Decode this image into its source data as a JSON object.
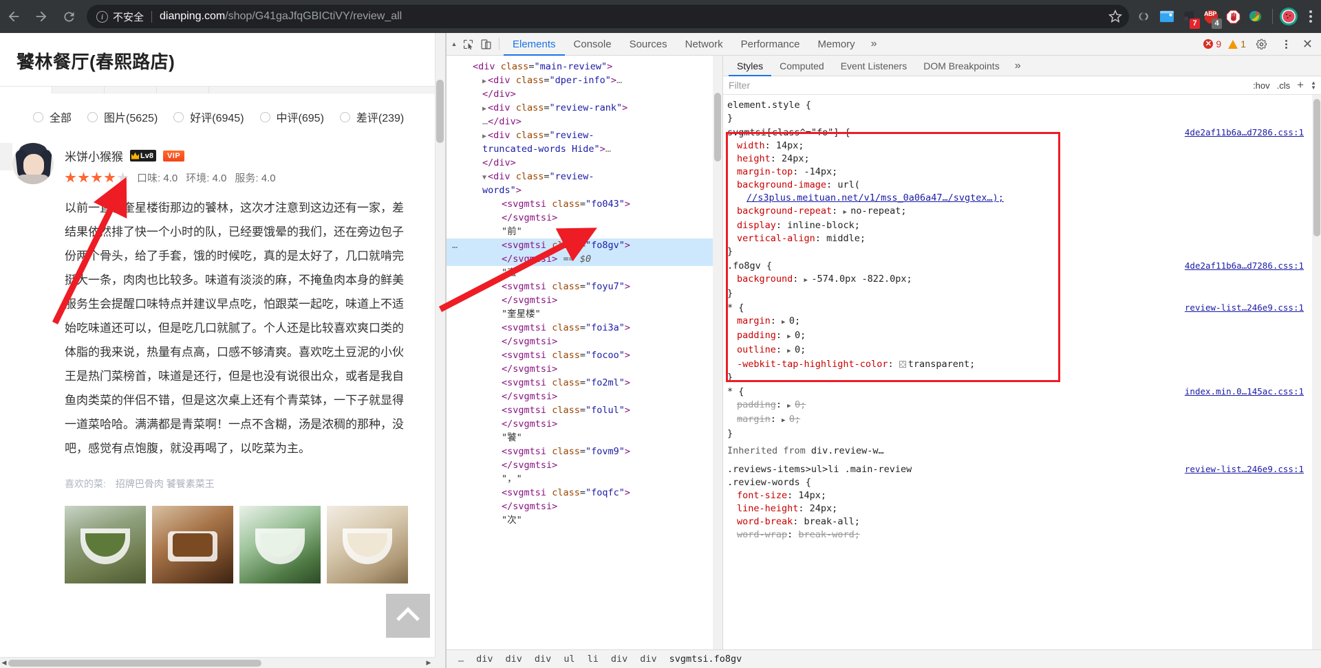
{
  "browser": {
    "back_icon": "back-arrow-icon",
    "forward_icon": "forward-arrow-icon",
    "reload_icon": "reload-icon",
    "security_label": "不安全",
    "url_host": "dianping.com",
    "url_path": "/shop/G41gaJfqGBICtiVY/review_all",
    "star_icon": "bookmark-star-icon",
    "extensions": [
      {
        "name": "link-extension-icon",
        "badge": ""
      },
      {
        "name": "window-extension-icon",
        "badge": ""
      },
      {
        "name": "dark-square-extension-icon",
        "badge": "7"
      },
      {
        "name": "adblock-plus-icon",
        "label": "ABP",
        "badge": "4"
      },
      {
        "name": "adblock-stop-hand-icon",
        "badge": ""
      },
      {
        "name": "colorful-globe-extension-icon",
        "badge": ""
      }
    ],
    "profile_icon": "watermelon-avatar-icon",
    "menu_icon": "three-dot-menu-icon"
  },
  "page": {
    "title": "饕林餐厅(春熙路店)",
    "filters": [
      {
        "label": "全部"
      },
      {
        "label": "图片(5625)"
      },
      {
        "label": "好评(6945)"
      },
      {
        "label": "中评(695)"
      },
      {
        "label": "差评(239)"
      }
    ],
    "review": {
      "user_name": "米饼小猴猴",
      "level_badge": "Lv8",
      "vip_badge": "VIP",
      "stars_filled": 4,
      "stars_total": 5,
      "scores": [
        {
          "label": "口味:",
          "value": "4.0"
        },
        {
          "label": "环境:",
          "value": "4.0"
        },
        {
          "label": "服务:",
          "value": "4.0"
        }
      ],
      "text_lines": [
        "以前一直在奎星楼街那边的饕林，这次才注意到这边还有一家，差",
        "结果依然排了快一个小时的队，已经要饿晕的我们，还在旁边包子",
        "份两个骨头，给了手套，饿的时候吃，真的是太好了，几口就啃完",
        "挺大一条，肉肉也比较多。味道有淡淡的麻，不掩鱼肉本身的鲜美",
        "服务生会提醒口味特点并建议早点吃，怕跟菜一起吃，味道上不适",
        "始吃味道还可以，但是吃几口就腻了。个人还是比较喜欢爽口类的",
        "体脂的我来说，热量有点高，口感不够清爽。喜欢吃土豆泥的小伙",
        "王是热门菜榜首，味道是还行，但是也没有说很出众，或者是我自",
        "鱼肉类菜的伴侣不错，但是这次桌上还有个青菜钵，一下子就显得",
        "一道菜哈哈。满满都是青菜啊！一点不含糊，汤是浓稠的那种，没",
        "吧，感觉有点饱腹，就没再喝了，以吃菜为主。"
      ],
      "liked_label": "喜欢的菜:",
      "liked_dishes": "招牌巴骨肉  饕餮素菜王",
      "photo_count": 4
    },
    "back_to_top_icon": "back-to-top-chevron-icon"
  },
  "devtools": {
    "inspect_icon": "inspect-element-icon",
    "device_icon": "device-toolbar-icon",
    "tabs": [
      {
        "label": "Elements",
        "active": true
      },
      {
        "label": "Console",
        "active": false
      },
      {
        "label": "Sources",
        "active": false
      },
      {
        "label": "Network",
        "active": false
      },
      {
        "label": "Performance",
        "active": false
      },
      {
        "label": "Memory",
        "active": false
      }
    ],
    "more_tabs_icon": "chevron-double-right-icon",
    "error_count": "9",
    "warning_count": "1",
    "settings_icon": "gear-icon",
    "kebab_icon": "three-dot-menu-icon",
    "close_icon": "close-icon",
    "dom_lines": [
      {
        "indent": 2,
        "tri": "",
        "html": "<span class=\"punct\">&lt;</span><span class=\"tag\">div</span> <span class=\"attr\">class</span>=<span class=\"val\">\"main-review\"</span><span class=\"punct\">&gt;</span>",
        "sel": false
      },
      {
        "indent": 3,
        "tri": "right",
        "html": "<span class=\"punct\">&lt;</span><span class=\"tag\">div</span> <span class=\"attr\">class</span>=<span class=\"val\">\"dper-info\"</span><span class=\"punct\">&gt;</span><span class=\"ellip\">…</span>",
        "sel": false
      },
      {
        "indent": 3,
        "tri": "",
        "html": "<span class=\"punct\">&lt;/</span><span class=\"tag\">div</span><span class=\"punct\">&gt;</span>",
        "sel": false
      },
      {
        "indent": 3,
        "tri": "right",
        "html": "<span class=\"punct\">&lt;</span><span class=\"tag\">div</span> <span class=\"attr\">class</span>=<span class=\"val\">\"review-rank\"</span><span class=\"punct\">&gt;</span>",
        "sel": false
      },
      {
        "indent": 3,
        "tri": "",
        "html": "<span class=\"ellip\">…</span><span class=\"punct\">&lt;/</span><span class=\"tag\">div</span><span class=\"punct\">&gt;</span>",
        "sel": false
      },
      {
        "indent": 3,
        "tri": "right",
        "html": "<span class=\"punct\">&lt;</span><span class=\"tag\">div</span> <span class=\"attr\">class</span>=<span class=\"val\">\"review-</span>",
        "sel": false
      },
      {
        "indent": 3,
        "tri": "",
        "html": "<span class=\"val\">truncated-words Hide\"</span><span class=\"punct\">&gt;</span><span class=\"ellip\">…</span>",
        "sel": false
      },
      {
        "indent": 3,
        "tri": "",
        "html": "<span class=\"punct\">&lt;/</span><span class=\"tag\">div</span><span class=\"punct\">&gt;</span>",
        "sel": false
      },
      {
        "indent": 3,
        "tri": "down",
        "html": "<span class=\"punct\">&lt;</span><span class=\"tag\">div</span> <span class=\"attr\">class</span>=<span class=\"val\">\"review-</span>",
        "sel": false
      },
      {
        "indent": 3,
        "tri": "",
        "html": "<span class=\"val\">words\"</span><span class=\"punct\">&gt;</span>",
        "sel": false
      },
      {
        "indent": 5,
        "tri": "",
        "html": "<span class=\"punct\">&lt;</span><span class=\"tag\">svgmtsi</span> <span class=\"attr\">class</span>=<span class=\"val\">\"fo043\"</span><span class=\"punct\">&gt;</span>",
        "sel": false
      },
      {
        "indent": 5,
        "tri": "",
        "html": "<span class=\"punct\">&lt;/</span><span class=\"tag\">svgmtsi</span><span class=\"punct\">&gt;</span>",
        "sel": false
      },
      {
        "indent": 5,
        "tri": "",
        "html": "<span class=\"txt\">\"前\"</span>",
        "sel": false
      },
      {
        "indent": 5,
        "tri": "",
        "html": "<span class=\"punct\">&lt;</span><span class=\"tag\">svgmtsi</span> <span class=\"attr\">class</span>=<span class=\"val\">\"fo8gv\"</span><span class=\"punct\">&gt;</span>",
        "sel": true
      },
      {
        "indent": 5,
        "tri": "",
        "html": "<span class=\"punct\">&lt;/</span><span class=\"tag\">svgmtsi</span><span class=\"punct\">&gt;</span> <span class=\"dollar\">== $0</span>",
        "sel": true
      },
      {
        "indent": 5,
        "tri": "",
        "html": "<span class=\"txt\">\"直\"</span>",
        "sel": false
      },
      {
        "indent": 5,
        "tri": "",
        "html": "<span class=\"punct\">&lt;</span><span class=\"tag\">svgmtsi</span> <span class=\"attr\">class</span>=<span class=\"val\">\"foyu7\"</span><span class=\"punct\">&gt;</span>",
        "sel": false
      },
      {
        "indent": 5,
        "tri": "",
        "html": "<span class=\"punct\">&lt;/</span><span class=\"tag\">svgmtsi</span><span class=\"punct\">&gt;</span>",
        "sel": false
      },
      {
        "indent": 5,
        "tri": "",
        "html": "<span class=\"txt\">\"奎星楼\"</span>",
        "sel": false
      },
      {
        "indent": 5,
        "tri": "",
        "html": "<span class=\"punct\">&lt;</span><span class=\"tag\">svgmtsi</span> <span class=\"attr\">class</span>=<span class=\"val\">\"foi3a\"</span><span class=\"punct\">&gt;</span>",
        "sel": false
      },
      {
        "indent": 5,
        "tri": "",
        "html": "<span class=\"punct\">&lt;/</span><span class=\"tag\">svgmtsi</span><span class=\"punct\">&gt;</span>",
        "sel": false
      },
      {
        "indent": 5,
        "tri": "",
        "html": "<span class=\"punct\">&lt;</span><span class=\"tag\">svgmtsi</span> <span class=\"attr\">class</span>=<span class=\"val\">\"focoo\"</span><span class=\"punct\">&gt;</span>",
        "sel": false
      },
      {
        "indent": 5,
        "tri": "",
        "html": "<span class=\"punct\">&lt;/</span><span class=\"tag\">svgmtsi</span><span class=\"punct\">&gt;</span>",
        "sel": false
      },
      {
        "indent": 5,
        "tri": "",
        "html": "<span class=\"punct\">&lt;</span><span class=\"tag\">svgmtsi</span> <span class=\"attr\">class</span>=<span class=\"val\">\"fo2ml\"</span><span class=\"punct\">&gt;</span>",
        "sel": false
      },
      {
        "indent": 5,
        "tri": "",
        "html": "<span class=\"punct\">&lt;/</span><span class=\"tag\">svgmtsi</span><span class=\"punct\">&gt;</span>",
        "sel": false
      },
      {
        "indent": 5,
        "tri": "",
        "html": "<span class=\"punct\">&lt;</span><span class=\"tag\">svgmtsi</span> <span class=\"attr\">class</span>=<span class=\"val\">\"folul\"</span><span class=\"punct\">&gt;</span>",
        "sel": false
      },
      {
        "indent": 5,
        "tri": "",
        "html": "<span class=\"punct\">&lt;/</span><span class=\"tag\">svgmtsi</span><span class=\"punct\">&gt;</span>",
        "sel": false
      },
      {
        "indent": 5,
        "tri": "",
        "html": "<span class=\"txt\">\"饕\"</span>",
        "sel": false
      },
      {
        "indent": 5,
        "tri": "",
        "html": "<span class=\"punct\">&lt;</span><span class=\"tag\">svgmtsi</span> <span class=\"attr\">class</span>=<span class=\"val\">\"fovm9\"</span><span class=\"punct\">&gt;</span>",
        "sel": false
      },
      {
        "indent": 5,
        "tri": "",
        "html": "<span class=\"punct\">&lt;/</span><span class=\"tag\">svgmtsi</span><span class=\"punct\">&gt;</span>",
        "sel": false
      },
      {
        "indent": 5,
        "tri": "",
        "html": "<span class=\"txt\">\"，\"</span>",
        "sel": false
      },
      {
        "indent": 5,
        "tri": "",
        "html": "<span class=\"punct\">&lt;</span><span class=\"tag\">svgmtsi</span> <span class=\"attr\">class</span>=<span class=\"val\">\"foqfc\"</span><span class=\"punct\">&gt;</span>",
        "sel": false
      },
      {
        "indent": 5,
        "tri": "",
        "html": "<span class=\"punct\">&lt;/</span><span class=\"tag\">svgmtsi</span><span class=\"punct\">&gt;</span>",
        "sel": false
      },
      {
        "indent": 5,
        "tri": "",
        "html": "<span class=\"txt\">\"次\"</span>",
        "sel": false
      }
    ],
    "styles_tabs": [
      {
        "label": "Styles",
        "active": true
      },
      {
        "label": "Computed",
        "active": false
      },
      {
        "label": "Event Listeners",
        "active": false
      },
      {
        "label": "DOM Breakpoints",
        "active": false
      }
    ],
    "styles_more_icon": "chevron-double-right-icon",
    "filter_placeholder": "Filter",
    "hov_label": ":hov",
    "cls_label": ".cls",
    "plus_label": "+",
    "element_style": "element.style {",
    "element_style_close": "}",
    "rules": [
      {
        "selector": "svgmtsi[class^=\"fo\"] {",
        "source": "4de2af11b6a…d7286.css:1",
        "close": "}",
        "declarations": [
          {
            "prop": "width",
            "value": "14px;"
          },
          {
            "prop": "height",
            "value": "24px;"
          },
          {
            "prop": "margin-top",
            "value": "-14px;"
          },
          {
            "prop": "background-image",
            "value": "url("
          },
          {
            "prop": "",
            "value": "//s3plus.meituan.net/v1/mss_0a06a47…/svgtex…);",
            "link": true,
            "indent": true
          },
          {
            "prop": "background-repeat",
            "value": "no-repeat;",
            "arrow": true
          },
          {
            "prop": "display",
            "value": "inline-block;"
          },
          {
            "prop": "vertical-align",
            "value": "middle;"
          }
        ]
      },
      {
        "selector": ".fo8gv {",
        "source": "4de2af11b6a…d7286.css:1",
        "close": "}",
        "declarations": [
          {
            "prop": "background",
            "value": "-574.0px -822.0px;",
            "arrow": true
          }
        ]
      },
      {
        "selector": "* {",
        "source": "review-list…246e9.css:1",
        "close": "}",
        "declarations": [
          {
            "prop": "margin",
            "value": "0;",
            "arrow": true
          },
          {
            "prop": "padding",
            "value": "0;",
            "arrow": true
          },
          {
            "prop": "outline",
            "value": "0;",
            "arrow": true
          },
          {
            "prop": "-webkit-tap-highlight-color",
            "value": "transparent;",
            "swatch": "transparent"
          }
        ]
      },
      {
        "selector": "* {",
        "source": "index.min.0…145ac.css:1",
        "close": "}",
        "declarations": [
          {
            "prop": "padding",
            "value": "0;",
            "arrow": true,
            "struck": true
          },
          {
            "prop": "margin",
            "value": "0;",
            "arrow": true,
            "struck": true
          }
        ]
      }
    ],
    "inherited_label": "Inherited from",
    "inherited_target": "div.review-w…",
    "inherited_rules": [
      {
        "selector": ".reviews-items>ul>li .main-review",
        "selector2": ".review-words {",
        "source": "review-list…246e9.css:1",
        "declarations": [
          {
            "prop": "font-size",
            "value": "14px;"
          },
          {
            "prop": "line-height",
            "value": "24px;"
          },
          {
            "prop": "word-break",
            "value": "break-all;"
          },
          {
            "prop": "word-wrap",
            "value": "break-word;",
            "struck": true
          }
        ]
      }
    ],
    "breadcrumb": [
      "…",
      "div",
      "div",
      "div",
      "ul",
      "li",
      "div",
      "div",
      "svgmtsi.fo8gv"
    ]
  },
  "annotations": {
    "arrow_color": "#ee1c25",
    "highlight_box_color": "#ee1c25"
  }
}
